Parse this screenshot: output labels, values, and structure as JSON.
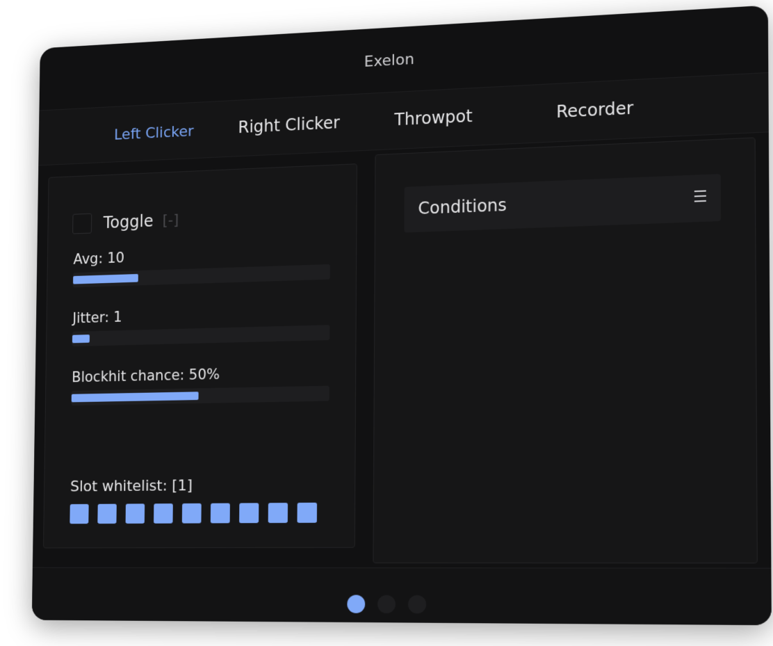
{
  "window": {
    "title": "Exelon"
  },
  "tabs": [
    {
      "label": "Left Clicker",
      "active": true
    },
    {
      "label": "Right Clicker",
      "active": false
    },
    {
      "label": "Throwpot",
      "active": false
    },
    {
      "label": "Recorder",
      "active": false
    }
  ],
  "left_panel": {
    "toggle": {
      "label": "Toggle",
      "checked": false,
      "bind": "[-]"
    },
    "sliders": [
      {
        "label": "Avg: 10",
        "fill_fraction": 0.26
      },
      {
        "label": "Jitter: 1",
        "fill_fraction": 0.07
      },
      {
        "label": "Blockhit chance: 50%",
        "fill_fraction": 0.5
      }
    ],
    "slot_whitelist": {
      "label": "Slot whitelist: [1]",
      "slot_count": 9
    }
  },
  "right_panel": {
    "conditions": {
      "label": "Conditions",
      "icon": "menu-icon"
    }
  },
  "pager": {
    "pages": 3,
    "active_index": 0
  },
  "colors": {
    "accent": "#80a9f8",
    "active_tab": "#7aa5f5",
    "background": "#111112"
  }
}
